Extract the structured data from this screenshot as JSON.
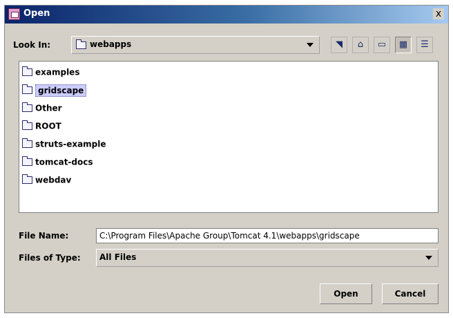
{
  "window": {
    "title": "Open",
    "close_glyph": "x"
  },
  "look_in": {
    "label": "Look In:",
    "value": "webapps"
  },
  "toolbar": {
    "icons": [
      "up-one-level-icon",
      "home-icon",
      "new-folder-icon",
      "list-view-icon",
      "details-view-icon"
    ]
  },
  "files": [
    {
      "name": "examples"
    },
    {
      "name": "gridscape",
      "selected": true
    },
    {
      "name": "Other"
    },
    {
      "name": "ROOT"
    },
    {
      "name": "struts-example"
    },
    {
      "name": "tomcat-docs"
    },
    {
      "name": "webdav"
    }
  ],
  "file_name": {
    "label": "File Name:",
    "value": "C:\\Program Files\\Apache Group\\Tomcat 4.1\\webapps\\gridscape"
  },
  "file_type": {
    "label": "Files of Type:",
    "value": "All Files"
  },
  "buttons": {
    "open": "Open",
    "cancel": "Cancel"
  },
  "colors": {
    "selection": "#ccccff",
    "title_bar": "#0a246a",
    "dialog_bg": "#d4d0c8"
  }
}
